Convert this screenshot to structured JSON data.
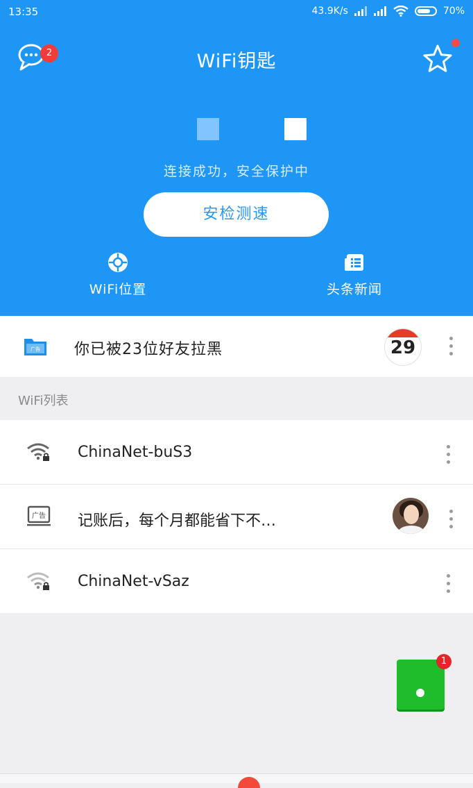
{
  "status_bar": {
    "time": "13:35",
    "speed": "43.9K/s",
    "battery": "70%"
  },
  "header": {
    "title": "WiFi钥匙",
    "message_badge": "2",
    "connected_text": "连接成功，安全保护中",
    "check_button": "安检测速",
    "quick_actions": [
      {
        "label": "WiFi位置",
        "icon": "locate-icon"
      },
      {
        "label": "头条新闻",
        "icon": "news-icon"
      }
    ]
  },
  "ad_banner": {
    "text": "你已被23位好友拉黑",
    "calendar_day": "29"
  },
  "wifi_list": {
    "title": "WiFi列表",
    "items": [
      {
        "text": "ChinaNet-buS3",
        "type": "wifi"
      },
      {
        "text": "记账后，每个月都能省下不…",
        "type": "ad",
        "ad_label": "广告"
      },
      {
        "text": "ChinaNet-vSaz",
        "type": "wifi"
      }
    ]
  },
  "floating": {
    "badge": "1"
  },
  "colors": {
    "primary": "#1e96f6",
    "badge_red": "#f23b3b",
    "float_green": "#1fbc2b"
  }
}
